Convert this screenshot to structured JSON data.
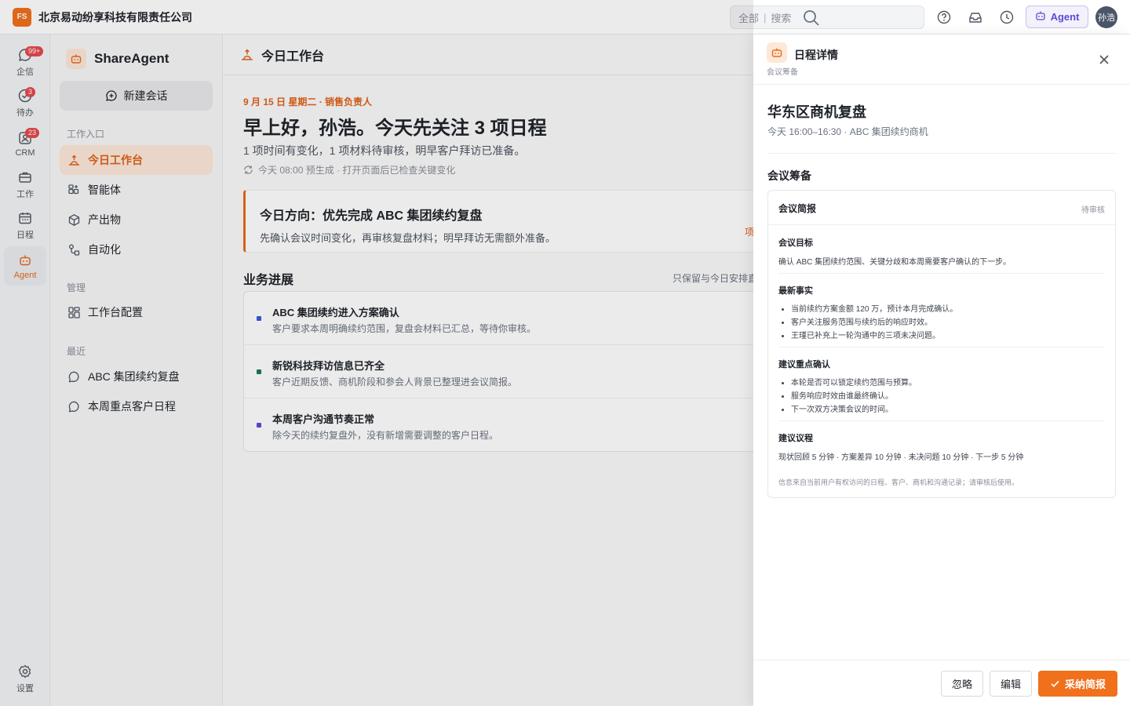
{
  "topbar": {
    "logo_text": "FS",
    "company": "北京易动纷享科技有限责任公司",
    "search_scope": "全部",
    "search_sep": "|",
    "search_placeholder": "搜索",
    "agent_label": "Agent",
    "user_initials": "孙浩"
  },
  "rail": {
    "items": [
      {
        "label": "企信",
        "icon": "chat-icon",
        "badge": "99+"
      },
      {
        "label": "待办",
        "icon": "check-circle-icon",
        "badge": "3"
      },
      {
        "label": "CRM",
        "icon": "contacts-icon",
        "badge": "23"
      },
      {
        "label": "工作",
        "icon": "briefcase-icon",
        "badge": ""
      },
      {
        "label": "日程",
        "icon": "calendar-icon",
        "badge": ""
      },
      {
        "label": "Agent",
        "icon": "robot-icon",
        "badge": ""
      }
    ],
    "settings_label": "设置"
  },
  "sidebar": {
    "title": "ShareAgent",
    "new_chat": "新建会话",
    "section_entry": "工作入口",
    "entry_items": [
      "今日工作台",
      "智能体",
      "产出物",
      "自动化"
    ],
    "section_manage": "管理",
    "manage_items": [
      "工作台配置"
    ],
    "section_recent": "最近",
    "recent_items": [
      "ABC 集团续约复盘",
      "本周重点客户日程"
    ]
  },
  "main": {
    "header": "今日工作台",
    "kicker": "9 月 15 日 星期二 · 销售负责人",
    "greeting": "早上好，孙浩。今天先关注 3 项日程",
    "summary": "1 项时间有变化，1 项材料待审核，明早客户拜访已准备。",
    "generated": "今天 08:00 预生成 · 打开页面后已检查关键变化",
    "focus_title": "今日方向：优先完成 ABC 集团续约复盘",
    "focus_desc": "先确认会议时间变化，再审核复盘材料；明早拜访无需额外准备。",
    "focus_more": "项",
    "progress_title": "业务进展",
    "progress_note": "只保留与今日安排直接",
    "progress": [
      {
        "title": "ABC 集团续约进入方案确认",
        "desc": "客户要求本周明确续约范围，复盘会材料已汇总，等待你审核。",
        "color": "#3b5bdb"
      },
      {
        "title": "新锐科技拜访信息已齐全",
        "desc": "客户近期反馈、商机阶段和参会人背景已整理进会议简报。",
        "color": "#1e7b4f"
      },
      {
        "title": "本周客户沟通节奏正常",
        "desc": "除今天的续约复盘外，没有新增需要调整的客户日程。",
        "color": "#5b4bd6"
      }
    ]
  },
  "drawer": {
    "title": "日程详情",
    "subtitle": "会议筹备",
    "event_title": "华东区商机复盘",
    "event_time": "今天 16:00–16:30 · ABC 集团续约商机",
    "prep_title": "会议筹备",
    "brief": {
      "title": "会议简报",
      "status": "待审核",
      "goal_h": "会议目标",
      "goal": "确认 ABC 集团续约范围、关键分歧和本周需要客户确认的下一步。",
      "facts_h": "最新事实",
      "facts": [
        "当前续约方案金额 120 万，预计本月完成确认。",
        "客户关注服务范围与续约后的响应时效。",
        "王瑾已补充上一轮沟通中的三项未决问题。"
      ],
      "confirm_h": "建议重点确认",
      "confirm": [
        "本轮是否可以锁定续约范围与预算。",
        "服务响应时效由谁最终确认。",
        "下一次双方决策会议的时间。"
      ],
      "agenda_h": "建议议程",
      "agenda": "现状回顾 5 分钟 · 方案差异 10 分钟 · 未决问题 10 分钟 · 下一步 5 分钟",
      "note": "信息来自当前用户有权访问的日程、客户、商机和沟通记录；请审核后使用。"
    },
    "buttons": {
      "ignore": "忽略",
      "edit": "编辑",
      "adopt": "采纳简报"
    }
  },
  "colors": {
    "accent": "#f0701c",
    "purple": "#5b4bd6"
  }
}
